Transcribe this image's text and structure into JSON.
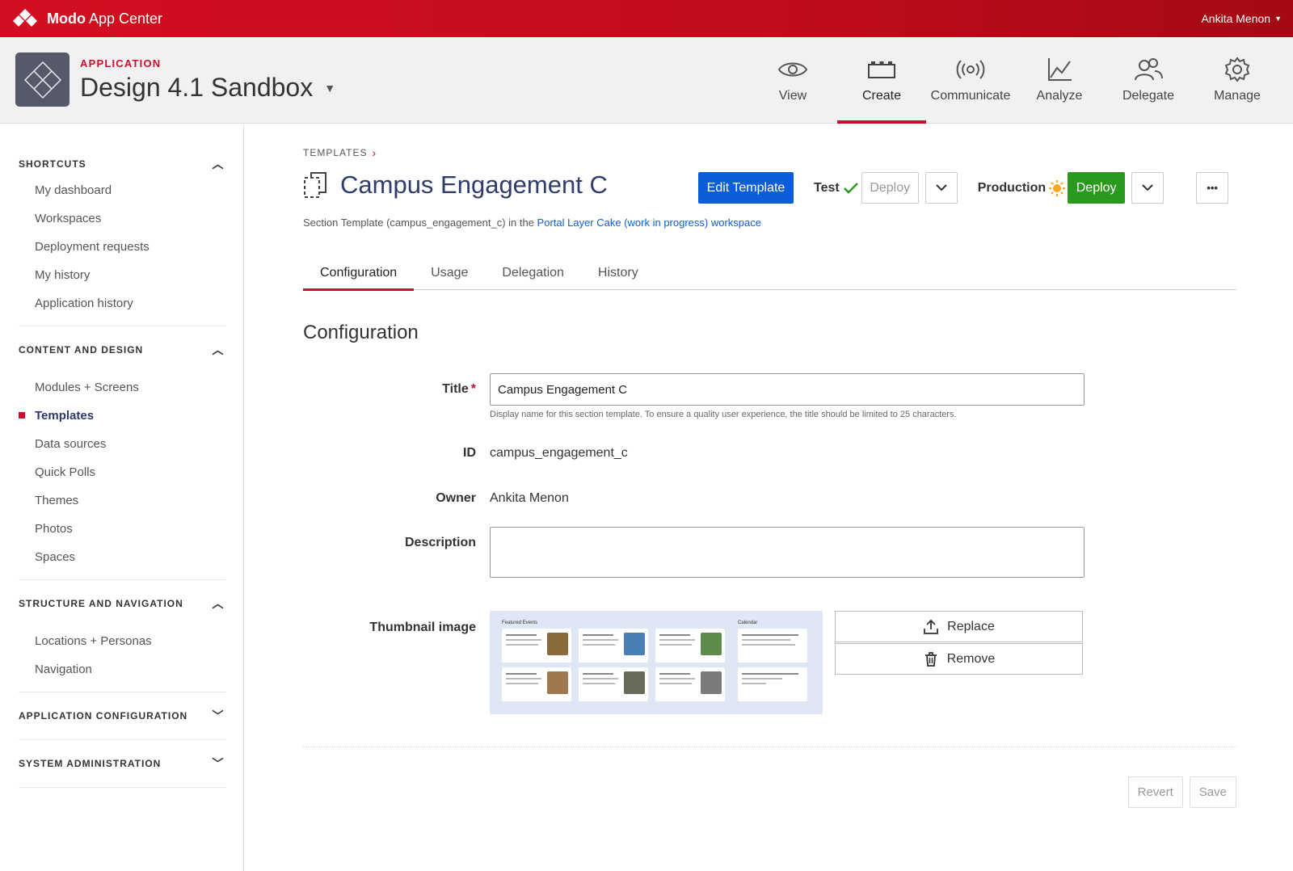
{
  "topbar": {
    "brand_bold": "Modo",
    "brand_rest": " App Center",
    "user_name": "Ankita Menon"
  },
  "app": {
    "eyebrow": "APPLICATION",
    "name": "Design 4.1 Sandbox"
  },
  "topnav": [
    {
      "label": "View",
      "icon": "eye-icon"
    },
    {
      "label": "Create",
      "icon": "blocks-icon",
      "active": true
    },
    {
      "label": "Communicate",
      "icon": "broadcast-icon"
    },
    {
      "label": "Analyze",
      "icon": "line-chart-icon"
    },
    {
      "label": "Delegate",
      "icon": "users-icon"
    },
    {
      "label": "Manage",
      "icon": "gear-icon"
    }
  ],
  "sidebar": {
    "sections": [
      {
        "title": "SHORTCUTS",
        "expanded": true,
        "items": [
          "My dashboard",
          "Workspaces",
          "Deployment requests",
          "My history",
          "Application history"
        ]
      },
      {
        "title": "CONTENT AND DESIGN",
        "expanded": true,
        "items": [
          "Modules + Screens",
          "Templates",
          "Data sources",
          "Quick Polls",
          "Themes",
          "Photos",
          "Spaces"
        ],
        "active": "Templates"
      },
      {
        "title": "STRUCTURE AND NAVIGATION",
        "expanded": true,
        "items": [
          "Locations + Personas",
          "Navigation"
        ]
      },
      {
        "title": "APPLICATION CONFIGURATION",
        "expanded": false,
        "items": []
      },
      {
        "title": "SYSTEM ADMINISTRATION",
        "expanded": false,
        "items": []
      }
    ]
  },
  "breadcrumb": "TEMPLATES",
  "page": {
    "title": "Campus Engagement C",
    "edit_button": "Edit Template",
    "test_label": "Test",
    "test_deploy": "Deploy",
    "production_label": "Production",
    "production_deploy": "Deploy",
    "more": "•••",
    "subline_prefix": "Section Template (campus_engagement_c) in the ",
    "subline_link": "Portal Layer Cake (work in progress) workspace"
  },
  "tabs": [
    "Configuration",
    "Usage",
    "Delegation",
    "History"
  ],
  "config": {
    "heading": "Configuration",
    "title_label": "Title",
    "title_value": "Campus Engagement C",
    "title_help": "Display name for this section template. To ensure a quality user experience, the title should be limited to 25 characters.",
    "id_label": "ID",
    "id_value": "campus_engagement_c",
    "owner_label": "Owner",
    "owner_value": "Ankita Menon",
    "description_label": "Description",
    "description_value": "",
    "thumbnail_label": "Thumbnail image",
    "thumb_featured": "Featured Events",
    "thumb_calendar": "Calendar",
    "replace_button": "Replace",
    "remove_button": "Remove"
  },
  "footer": {
    "revert": "Revert",
    "save": "Save"
  },
  "colors": {
    "brand_red": "#c8102e",
    "primary_blue": "#0b5ed7",
    "deploy_green": "#2a9a1e",
    "title_navy": "#2f3d6b"
  }
}
